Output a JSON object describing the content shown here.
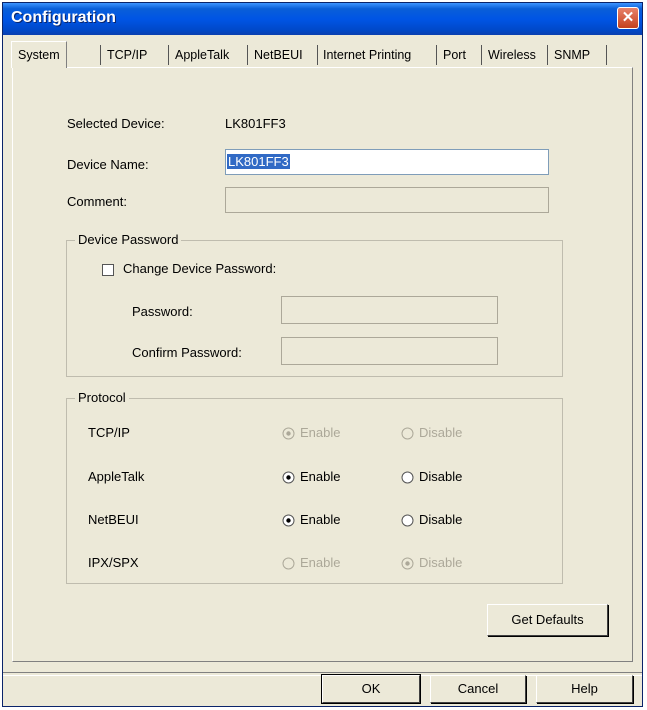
{
  "window": {
    "title": "Configuration",
    "close_label": "✕"
  },
  "tabs": [
    {
      "label": "System",
      "selected": true
    },
    {
      "label": "TCP/IP",
      "selected": false
    },
    {
      "label": "AppleTalk",
      "selected": false
    },
    {
      "label": "NetBEUI",
      "selected": false
    },
    {
      "label": "Internet Printing",
      "selected": false
    },
    {
      "label": "Port",
      "selected": false
    },
    {
      "label": "Wireless",
      "selected": false
    },
    {
      "label": "SNMP",
      "selected": false
    }
  ],
  "system": {
    "selected_device_label": "Selected Device:",
    "selected_device_value": "LK801FF3",
    "device_name_label": "Device Name:",
    "device_name_value": "LK801FF3",
    "comment_label": "Comment:",
    "comment_value": ""
  },
  "device_password": {
    "legend": "Device Password",
    "change_label": "Change Device Password:",
    "change_checked": false,
    "password_label": "Password:",
    "confirm_label": "Confirm Password:"
  },
  "protocol": {
    "legend": "Protocol",
    "enable_label": "Enable",
    "disable_label": "Disable",
    "rows": [
      {
        "name": "TCP/IP",
        "selected": "enable",
        "disabled": true
      },
      {
        "name": "AppleTalk",
        "selected": "enable",
        "disabled": false
      },
      {
        "name": "NetBEUI",
        "selected": "enable",
        "disabled": false
      },
      {
        "name": "IPX/SPX",
        "selected": "disable",
        "disabled": true
      }
    ]
  },
  "buttons": {
    "get_defaults": "Get Defaults",
    "ok": "OK",
    "cancel": "Cancel",
    "help": "Help"
  }
}
